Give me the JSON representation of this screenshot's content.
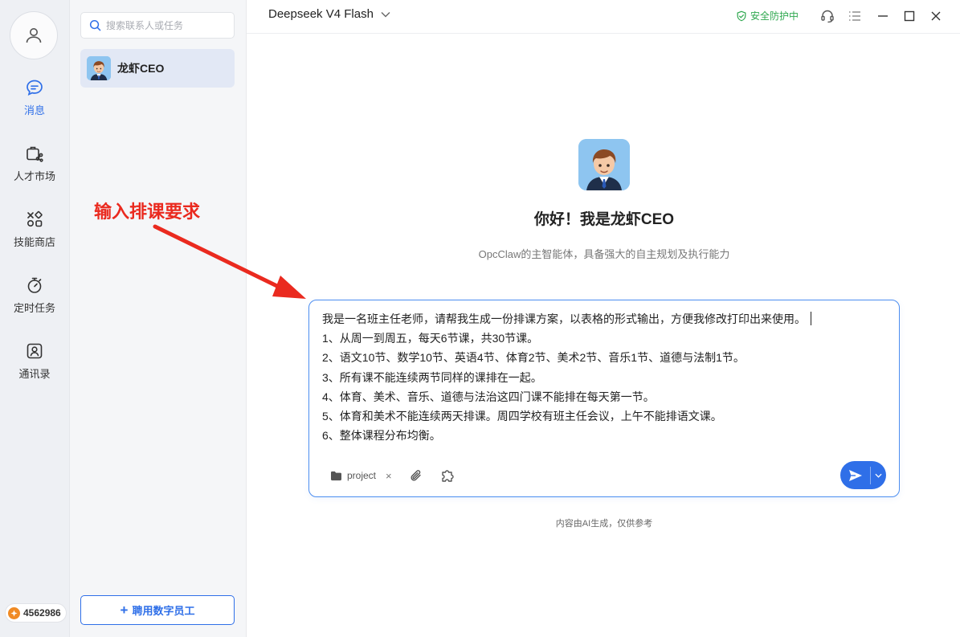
{
  "rail": {
    "items": [
      {
        "label": "消息",
        "icon": "chat-bubble-icon",
        "active": true
      },
      {
        "label": "人才市场",
        "icon": "briefcase-share-icon"
      },
      {
        "label": "技能商店",
        "icon": "apps-grid-icon"
      },
      {
        "label": "定时任务",
        "icon": "stopwatch-icon"
      },
      {
        "label": "通讯录",
        "icon": "contact-card-icon"
      }
    ],
    "points": "4562986"
  },
  "contacts": {
    "search_placeholder": "搜索联系人或任务",
    "items": [
      {
        "name": "龙虾CEO"
      }
    ],
    "hire_label": "聘用数字员工"
  },
  "header": {
    "model": "Deepseek V4 Flash",
    "security": "安全防护中"
  },
  "welcome": {
    "greeting": "你好！我是龙虾CEO",
    "subtitle": "OpcClaw的主智能体，具备强大的自主规划及执行能力"
  },
  "annotation": "输入排课要求",
  "composer": {
    "lines": [
      "我是一名班主任老师，请帮我生成一份排课方案，以表格的形式输出，方便我修改打印出来使用。",
      "1、从周一到周五，每天6节课，共30节课。",
      "2、语文10节、数学10节、英语4节、体育2节、美术2节、音乐1节、道德与法制1节。",
      "3、所有课不能连续两节同样的课排在一起。",
      "4、体育、美术、音乐、道德与法治这四门课不能排在每天第一节。",
      "5、体育和美术不能连续两天排课。周四学校有班主任会议，上午不能排语文课。",
      "6、整体课程分布均衡。"
    ],
    "project_label": "project",
    "close_glyph": "×"
  },
  "disclaimer": "内容由AI生成，仅供参考",
  "colors": {
    "accent": "#2f6fe8",
    "security": "#2fa84f",
    "annotation": "#ea2a1f",
    "rail_bg": "#eef0f4",
    "list_bg": "#f5f6f8"
  }
}
